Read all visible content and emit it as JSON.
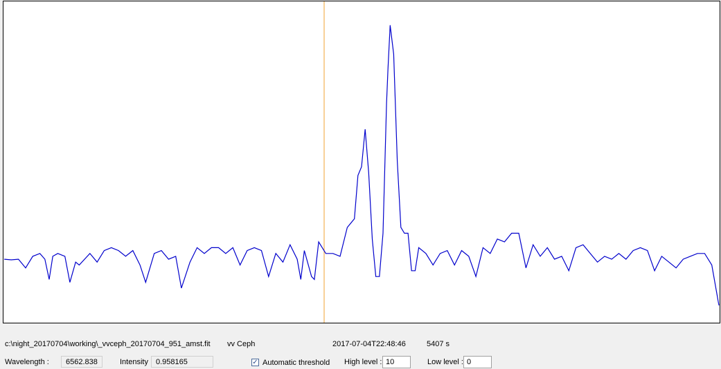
{
  "spectrum": {
    "line_color": "#0000cc",
    "cursor_color": "#f0a030",
    "cursor_wavelength": 6562.838,
    "chart_data": {
      "type": "line",
      "title": "",
      "xlabel": "",
      "ylabel": "",
      "grid": false,
      "x_norm": [
        0,
        0.01,
        0.02,
        0.03,
        0.04,
        0.05,
        0.057,
        0.063,
        0.068,
        0.075,
        0.085,
        0.092,
        0.1,
        0.105,
        0.12,
        0.13,
        0.14,
        0.15,
        0.16,
        0.17,
        0.18,
        0.19,
        0.198,
        0.21,
        0.22,
        0.23,
        0.24,
        0.248,
        0.26,
        0.27,
        0.28,
        0.29,
        0.3,
        0.31,
        0.32,
        0.33,
        0.34,
        0.35,
        0.36,
        0.37,
        0.38,
        0.39,
        0.4,
        0.41,
        0.415,
        0.42,
        0.43,
        0.434,
        0.44,
        0.45,
        0.46,
        0.47,
        0.48,
        0.49,
        0.495,
        0.5,
        0.505,
        0.51,
        0.515,
        0.52,
        0.525,
        0.53,
        0.535,
        0.537,
        0.54,
        0.545,
        0.55,
        0.555,
        0.56,
        0.565,
        0.57,
        0.575,
        0.58,
        0.59,
        0.6,
        0.61,
        0.62,
        0.63,
        0.64,
        0.65,
        0.66,
        0.67,
        0.68,
        0.69,
        0.7,
        0.71,
        0.72,
        0.73,
        0.74,
        0.75,
        0.76,
        0.77,
        0.78,
        0.79,
        0.8,
        0.81,
        0.82,
        0.83,
        0.84,
        0.85,
        0.86,
        0.87,
        0.88,
        0.89,
        0.9,
        0.91,
        0.92,
        0.93,
        0.94,
        0.95,
        0.96,
        0.97,
        0.98,
        0.99,
        1.0
      ],
      "y": [
        0.16,
        0.158,
        0.16,
        0.13,
        0.17,
        0.18,
        0.16,
        0.09,
        0.17,
        0.18,
        0.17,
        0.08,
        0.15,
        0.14,
        0.18,
        0.15,
        0.19,
        0.2,
        0.19,
        0.17,
        0.19,
        0.14,
        0.08,
        0.18,
        0.19,
        0.16,
        0.17,
        0.06,
        0.15,
        0.2,
        0.18,
        0.2,
        0.2,
        0.18,
        0.2,
        0.14,
        0.19,
        0.2,
        0.19,
        0.1,
        0.18,
        0.15,
        0.21,
        0.16,
        0.09,
        0.19,
        0.1,
        0.09,
        0.22,
        0.18,
        0.18,
        0.17,
        0.27,
        0.3,
        0.45,
        0.48,
        0.61,
        0.46,
        0.23,
        0.1,
        0.1,
        0.25,
        0.7,
        0.82,
        0.97,
        0.87,
        0.5,
        0.27,
        0.25,
        0.25,
        0.12,
        0.12,
        0.2,
        0.18,
        0.14,
        0.18,
        0.19,
        0.14,
        0.19,
        0.17,
        0.1,
        0.2,
        0.18,
        0.23,
        0.22,
        0.25,
        0.25,
        0.13,
        0.21,
        0.17,
        0.2,
        0.16,
        0.17,
        0.12,
        0.2,
        0.21,
        0.18,
        0.15,
        0.17,
        0.16,
        0.18,
        0.16,
        0.19,
        0.2,
        0.19,
        0.12,
        0.17,
        0.15,
        0.13,
        0.16,
        0.17,
        0.18,
        0.18,
        0.14,
        0.0
      ]
    }
  },
  "info": {
    "file_path": "c:\\night_20170704\\working\\_vvceph_20170704_951_amst.fit",
    "object_name": "vv Ceph",
    "date_time": "2017-07-04T22:48:46",
    "exposure": "5407 s"
  },
  "controls": {
    "wavelength_label": "Wavelength :",
    "wavelength_value": "6562.838",
    "intensity_label": "Intensity :",
    "intensity_value": "0.958165",
    "auto_threshold_label": "Automatic threshold",
    "auto_threshold_checked": true,
    "high_level_label": "High level :",
    "high_level_value": "10",
    "low_level_label": "Low level :",
    "low_level_value": "0"
  }
}
